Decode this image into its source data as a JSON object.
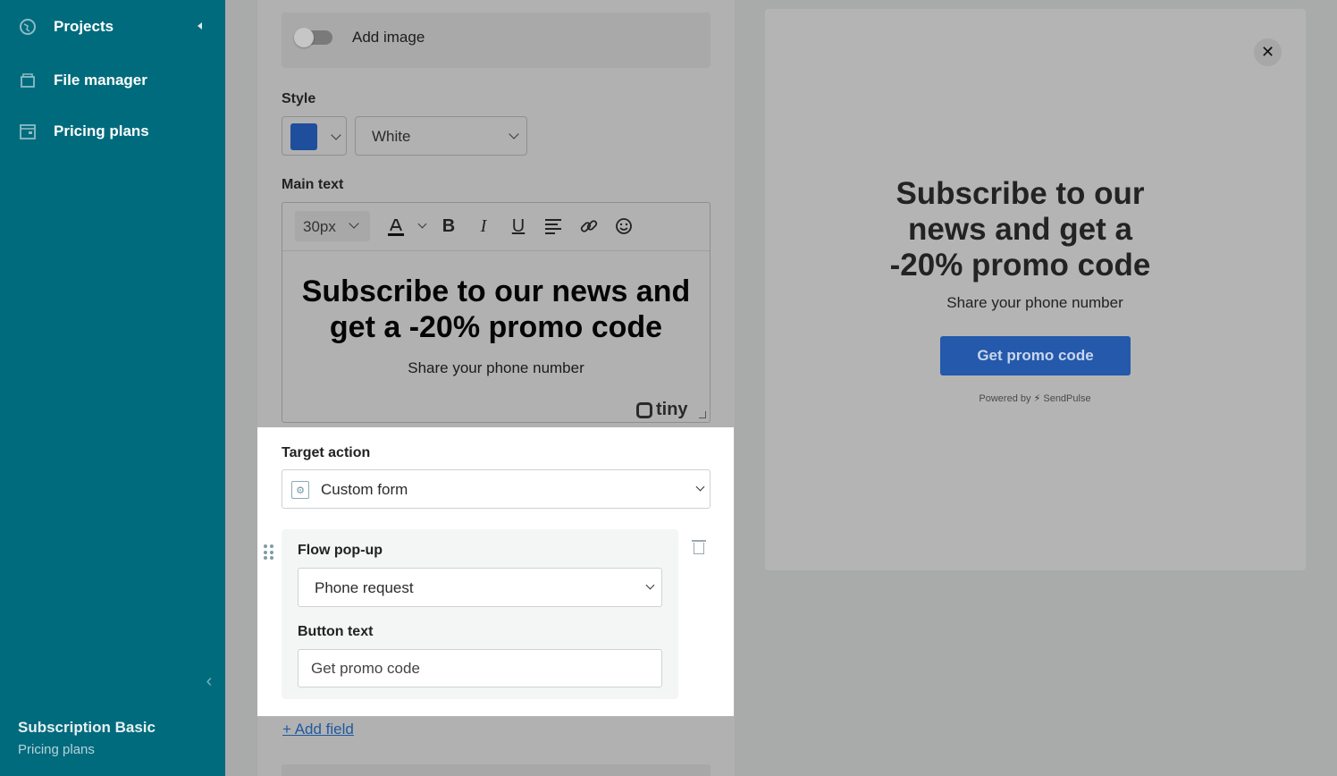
{
  "sidebar": {
    "items": [
      {
        "label": "Projects",
        "icon": "globe-icon"
      },
      {
        "label": "File manager",
        "icon": "folder-icon"
      },
      {
        "label": "Pricing plans",
        "icon": "wallet-icon"
      }
    ],
    "plan": {
      "title": "Subscription Basic",
      "subtitle": "Pricing plans"
    }
  },
  "editor": {
    "add_image_label": "Add image",
    "style_label": "Style",
    "style_color": "#1f4e9c",
    "style_value": "White",
    "main_text_label": "Main text",
    "font_size": "30px",
    "heading": "Subscribe to our news and get a -20% promo code",
    "subtext": "Share your phone number",
    "tiny_brand": "tiny"
  },
  "target": {
    "label": "Target action",
    "value": "Custom form",
    "flow_label": "Flow pop-up",
    "flow_value": "Phone request",
    "button_text_label": "Button text",
    "button_text_value": "Get promo code",
    "add_field": "+ Add field"
  },
  "preview": {
    "heading": "Subscribe to our news and get a -20% promo code",
    "subtext": "Share your phone number",
    "button": "Get promo code",
    "powered_by": "Powered by",
    "brand": "SendPulse",
    "accent": "#2459ac"
  }
}
